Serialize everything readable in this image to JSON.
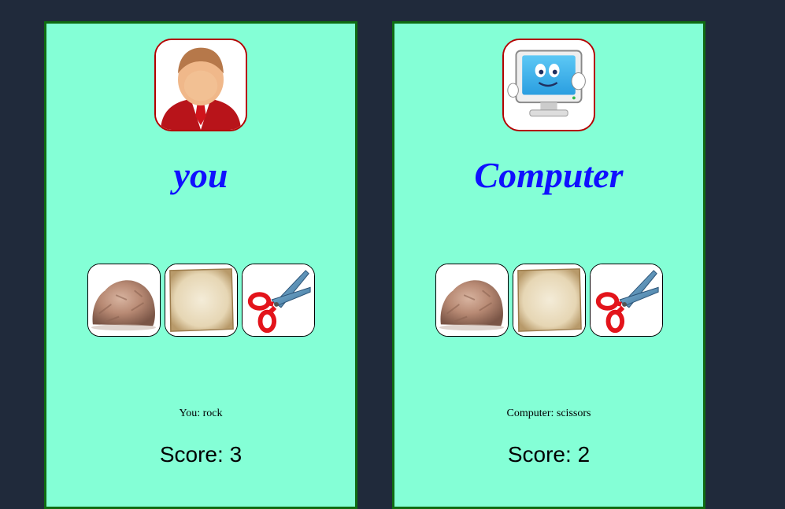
{
  "colors": {
    "page_background": "#202a3b",
    "panel_background": "#84ffd6",
    "panel_border": "#0f6b12",
    "name_color": "#1010ff"
  },
  "player": {
    "avatar_icon": "businessman-avatar-icon",
    "name": "you",
    "choices": [
      {
        "icon": "rock-icon"
      },
      {
        "icon": "paper-icon"
      },
      {
        "icon": "scissors-icon"
      }
    ],
    "last_move_text": "You: rock",
    "score_text": "Score: 3"
  },
  "computer": {
    "avatar_icon": "computer-monitor-icon",
    "name": "Computer",
    "choices": [
      {
        "icon": "rock-icon"
      },
      {
        "icon": "paper-icon"
      },
      {
        "icon": "scissors-icon"
      }
    ],
    "last_move_text": "Computer: scissors",
    "score_text": "Score: 2"
  }
}
